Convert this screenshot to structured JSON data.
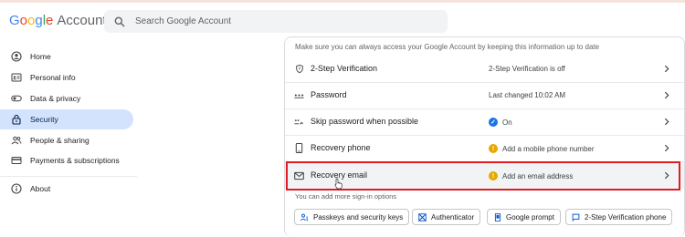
{
  "header": {
    "logo_brand": "Google",
    "logo_product": "Account",
    "search_placeholder": "Search Google Account"
  },
  "sidebar": {
    "items": [
      {
        "label": "Home",
        "icon": "home-icon"
      },
      {
        "label": "Personal info",
        "icon": "id-card-icon"
      },
      {
        "label": "Data & privacy",
        "icon": "toggle-icon"
      },
      {
        "label": "Security",
        "icon": "lock-icon",
        "active": true
      },
      {
        "label": "People & sharing",
        "icon": "people-icon"
      },
      {
        "label": "Payments & subscriptions",
        "icon": "credit-card-icon"
      }
    ],
    "about_label": "About"
  },
  "main": {
    "subtitle": "Make sure you can always access your Google Account by keeping this information up to date",
    "rows": [
      {
        "label": "2-Step Verification",
        "status": "2-Step Verification is off",
        "icon": "shield-icon"
      },
      {
        "label": "Password",
        "status": "Last changed 10:02 AM",
        "icon": "password-dots-icon"
      },
      {
        "label": "Skip password when possible",
        "status": "On",
        "status_icon": "check-circle-icon",
        "icon": "key-icon"
      },
      {
        "label": "Recovery phone",
        "status": "Add a mobile phone number",
        "status_icon": "warning-circle-icon",
        "icon": "phone-icon"
      },
      {
        "label": "Recovery email",
        "status": "Add an email address",
        "status_icon": "warning-circle-icon",
        "icon": "mail-icon"
      }
    ],
    "more_options_label": "You can add more sign-in options",
    "chips": [
      {
        "label": "Passkeys and security keys",
        "icon": "passkey-icon"
      },
      {
        "label": "Authenticator",
        "icon": "authenticator-icon"
      },
      {
        "label": "Google prompt",
        "icon": "phone-prompt-icon"
      },
      {
        "label": "2-Step Verification phone",
        "icon": "message-icon"
      }
    ]
  },
  "colors": {
    "active_nav": "#d3e3fd",
    "highlight_border": "#e01b24",
    "check_blue": "#1a73e8",
    "warning_amber": "#e37400"
  }
}
